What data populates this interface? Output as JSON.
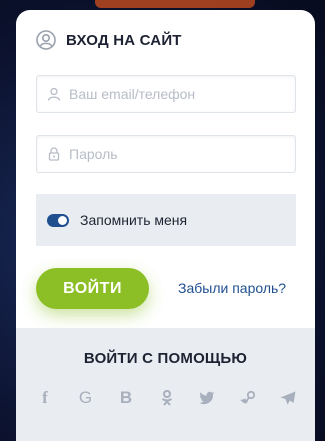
{
  "modal": {
    "title": "ВХОД НА САЙТ",
    "email_placeholder": "Ваш email/телефон",
    "password_placeholder": "Пароль",
    "remember_label": "Запомнить меня",
    "remember_checked": true,
    "login_button": "ВОЙТИ",
    "forgot_link": "Забыли пароль?",
    "social_title": "ВОЙТИ С ПОМОЩЬЮ",
    "social_icons": [
      "facebook-icon",
      "google-icon",
      "vk-icon",
      "odnoklassniki-icon",
      "twitter-icon",
      "steam-icon",
      "telegram-icon"
    ],
    "social_letters": {
      "facebook": "f",
      "google": "G",
      "vk": "B"
    }
  },
  "colors": {
    "accent_green": "#8cbf26",
    "link_blue": "#1f4f8f",
    "panel_gray": "#e9ecf1",
    "social_icon_gray": "#a9b0bd"
  }
}
